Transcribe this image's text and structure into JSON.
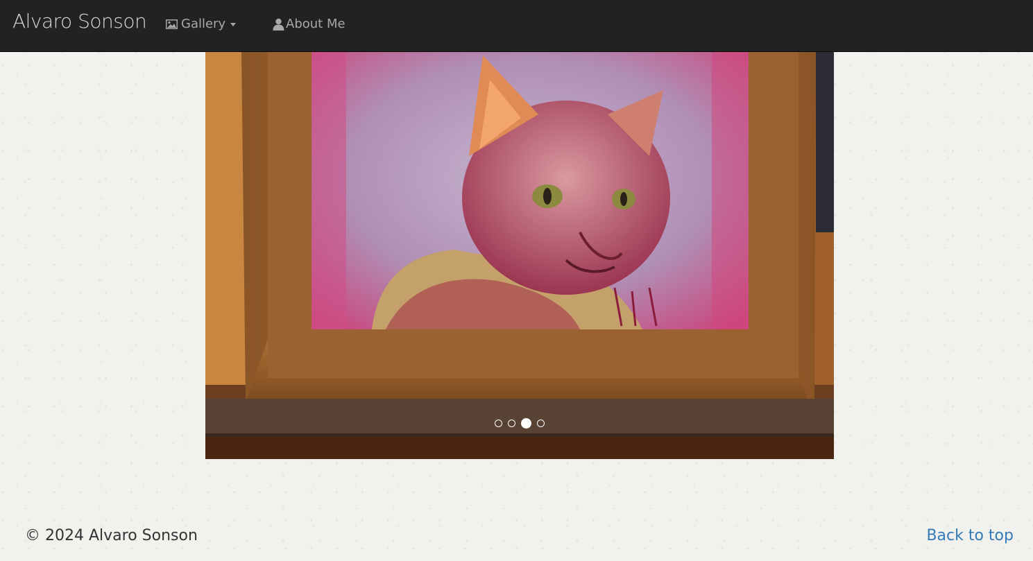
{
  "nav": {
    "brand": "Alvaro Sonson",
    "gallery_label": "Gallery",
    "gallery_icon": "picture-icon",
    "about_label": "About Me",
    "about_icon": "user-icon"
  },
  "carousel": {
    "slide_count": 4,
    "active_index": 2,
    "image_description_icon": "painting-image"
  },
  "footer": {
    "copyright": "© 2024 Alvaro Sonson",
    "back_to_top": "Back to top"
  },
  "colors": {
    "navbar_bg": "#222222",
    "nav_text": "#a8a8a8",
    "link": "#337ab7",
    "page_bg": "#f1f1ee"
  }
}
